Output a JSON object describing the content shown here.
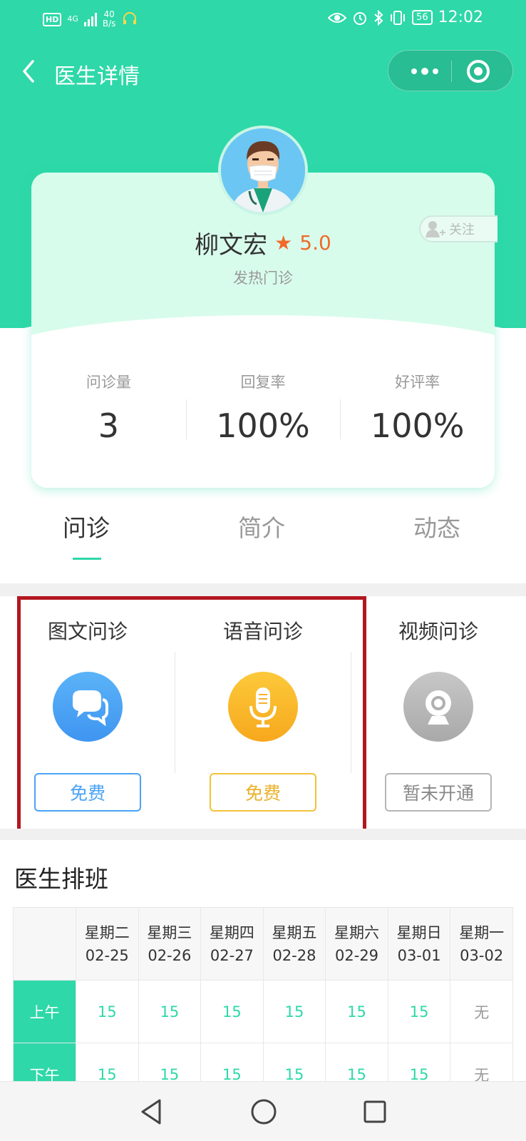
{
  "status_bar": {
    "hd": "HD",
    "network": "4G",
    "speed_value": "40",
    "speed_unit": "B/s",
    "battery": "56",
    "time": "12:02"
  },
  "nav": {
    "title": "医生详情"
  },
  "doctor": {
    "name": "柳文宏",
    "rating": "5.0",
    "department": "发热门诊",
    "follow_label": "关注"
  },
  "stats": [
    {
      "label": "问诊量",
      "value": "3"
    },
    {
      "label": "回复率",
      "value": "100%"
    },
    {
      "label": "好评率",
      "value": "100%"
    }
  ],
  "tabs": [
    {
      "label": "问诊",
      "active": true
    },
    {
      "label": "简介",
      "active": false
    },
    {
      "label": "动态",
      "active": false
    }
  ],
  "consultations": [
    {
      "title": "图文问诊",
      "button": "免费",
      "icon": "chat-bubbles-icon",
      "color": "#4aa3f5"
    },
    {
      "title": "语音问诊",
      "button": "免费",
      "icon": "microphone-icon",
      "color": "#fbb92a"
    },
    {
      "title": "视频问诊",
      "button": "暂未开通",
      "icon": "webcam-icon",
      "color": "#b5b5b5"
    }
  ],
  "schedule": {
    "title": "医生排班",
    "days": [
      {
        "weekday": "星期二",
        "date": "02-25"
      },
      {
        "weekday": "星期三",
        "date": "02-26"
      },
      {
        "weekday": "星期四",
        "date": "02-27"
      },
      {
        "weekday": "星期五",
        "date": "02-28"
      },
      {
        "weekday": "星期六",
        "date": "02-29"
      },
      {
        "weekday": "星期日",
        "date": "03-01"
      },
      {
        "weekday": "星期一",
        "date": "03-02"
      }
    ],
    "rows": [
      {
        "label": "上午",
        "cells": [
          "15",
          "15",
          "15",
          "15",
          "15",
          "15",
          "无"
        ]
      },
      {
        "label": "下午",
        "cells": [
          "15",
          "15",
          "15",
          "15",
          "15",
          "15",
          "无"
        ]
      }
    ]
  },
  "colors": {
    "primary": "#2ed8a8",
    "rating": "#f06a2a",
    "highlight_border": "#b3161f"
  }
}
